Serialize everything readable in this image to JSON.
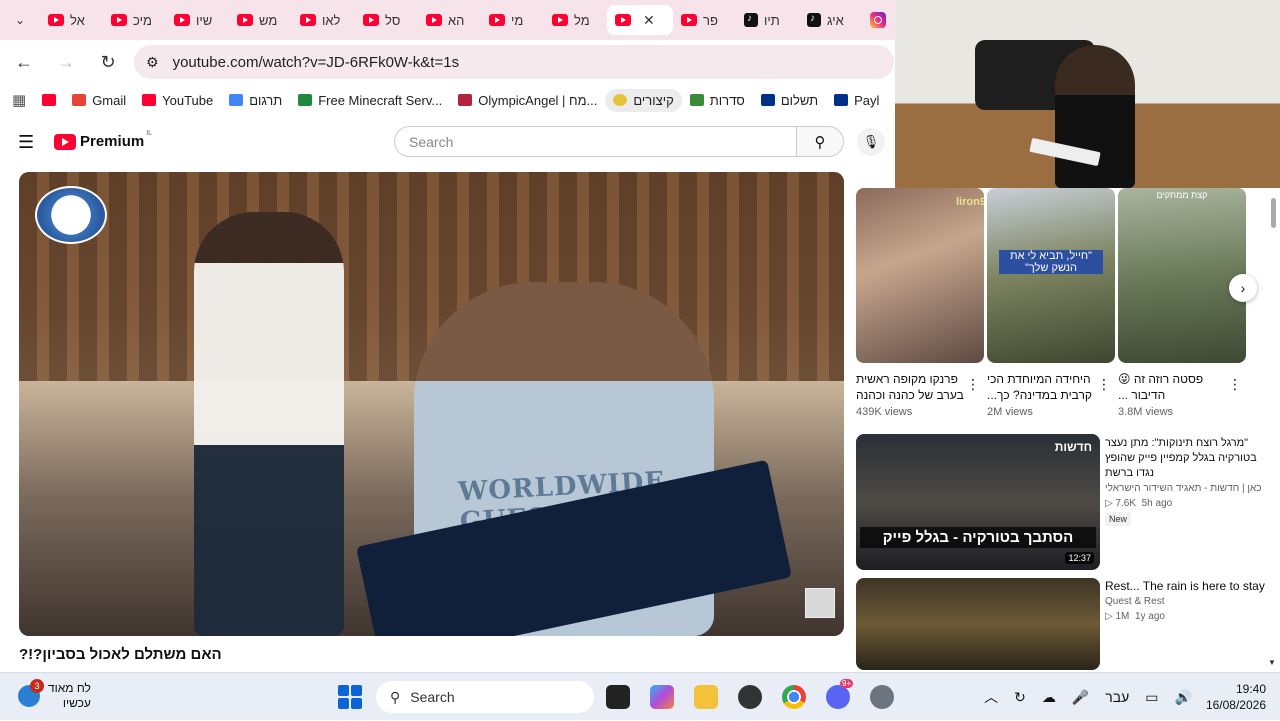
{
  "tabs": [
    {
      "label": "אל",
      "icon": "youtube-icon"
    },
    {
      "label": "מיכ",
      "icon": "youtube-icon"
    },
    {
      "label": "שיו",
      "icon": "youtube-icon"
    },
    {
      "label": "מש",
      "icon": "youtube-icon"
    },
    {
      "label": "לאו",
      "icon": "youtube-icon"
    },
    {
      "label": "סל",
      "icon": "youtube-icon"
    },
    {
      "label": "הא",
      "icon": "youtube-icon"
    },
    {
      "label": "מי",
      "icon": "youtube-icon"
    },
    {
      "label": "מל",
      "icon": "youtube-icon"
    },
    {
      "label": "",
      "icon": "youtube-icon",
      "active": true
    },
    {
      "label": "פר",
      "icon": "youtube-icon"
    },
    {
      "label": "תיו",
      "icon": "tiktok-icon"
    },
    {
      "label": "איג",
      "icon": "tiktok-icon"
    },
    {
      "label": "",
      "icon": "instagram-icon"
    }
  ],
  "address": {
    "url": "youtube.com/watch?v=JD-6RFk0W-k&t=1s"
  },
  "bookmarks": [
    {
      "label": "",
      "icon": "youtube-icon",
      "color": "#ff0033"
    },
    {
      "label": "Gmail",
      "icon": "gmail-icon",
      "color": "#ea4335"
    },
    {
      "label": "YouTube",
      "icon": "youtube-icon",
      "color": "#ff0033"
    },
    {
      "label": "תרגום",
      "icon": "translate-icon",
      "color": "#4285f4"
    },
    {
      "label": "Free Minecraft Serv...",
      "icon": "minecraft-icon",
      "color": "#1f8a3b"
    },
    {
      "label": "OlympicAngel | מח...",
      "icon": "olympic-icon",
      "color": "#b0253f"
    },
    {
      "label": "קיצורים",
      "icon": "sparkle-icon",
      "color": "#e6c13a"
    },
    {
      "label": "סדרות",
      "icon": "series-icon",
      "color": "#3b8b3b"
    },
    {
      "label": "תשלום",
      "icon": "paypal-icon",
      "color": "#003087"
    },
    {
      "label": "Payl",
      "icon": "paypal-icon",
      "color": "#003087"
    }
  ],
  "youtube": {
    "logo_text": "Premium",
    "country": "IL",
    "search_placeholder": "Search"
  },
  "video": {
    "title": "האם משתלם לאכול בסביון?!?"
  },
  "shorts": [
    {
      "title": "פרנקו מקופה ראשית בערב של כהנה וכהנה",
      "views": "439K views",
      "overlay": "liron959"
    },
    {
      "title": "היחידה המיוחדת הכי קרבית במדינה? כך...",
      "views": "2M views",
      "overlay": "\"חייל, תביא לי את הנשק שלך\""
    },
    {
      "title": "פסטה רוזה זה 😜 הדיבור ...",
      "views": "3.8M views",
      "overlay": "קצת ממתקים"
    }
  ],
  "recommendations": [
    {
      "title": "\"מרגל רוצח תינוקות\": מתן נעצר בטורקיה בגלל קמפיין פייק שהופץ נגדו ברשת",
      "channel": "כאן | חדשות - תאגיד השידור הישראלי",
      "views": "7.6K",
      "age": "5h ago",
      "badge": "New",
      "duration": "12:37",
      "thumb_caption": "הסתבך בטורקיה - בגלל פייק",
      "thumb_tag": "חדשות"
    },
    {
      "title": "Rest... The rain is here to stay",
      "channel": "Quest & Rest",
      "views": "1M",
      "age": "1y ago"
    }
  ],
  "taskbar": {
    "weather_title": "לח מאוד",
    "weather_sub": "עכשיו",
    "weather_badge": "3",
    "search": "Search",
    "discord_badge": "9+",
    "lang": "עבר",
    "time": "19:40",
    "date": "16/08/2026"
  }
}
